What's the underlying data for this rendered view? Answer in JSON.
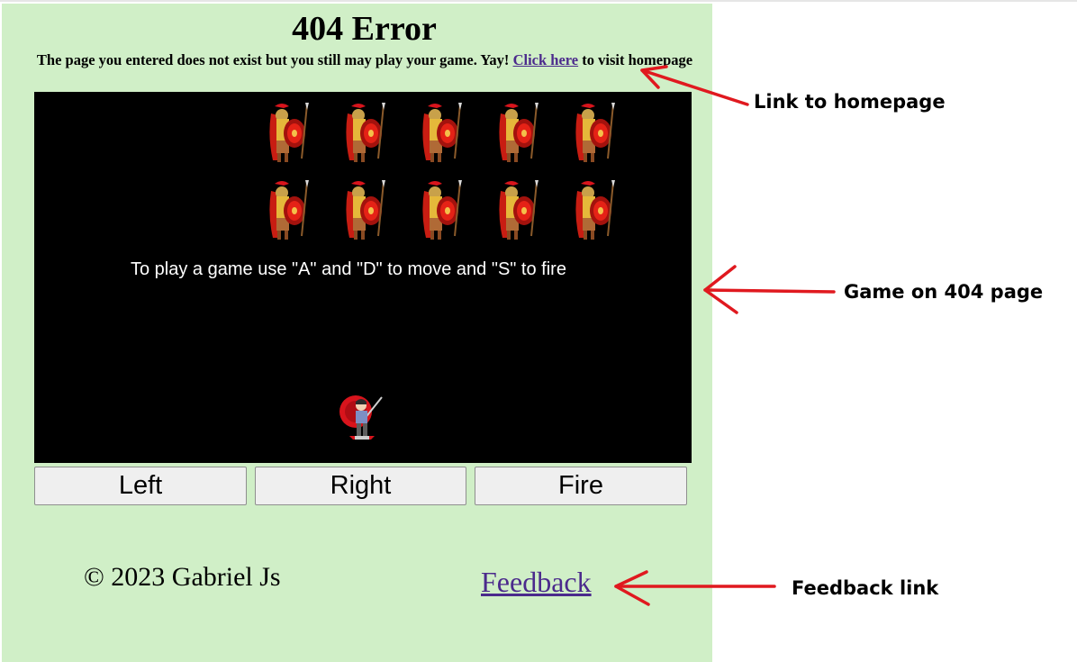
{
  "page": {
    "title": "404 Error",
    "subtitle_before": "The page you entered does not exist but you still may play your game. Yay! ",
    "home_link_label": "Click here",
    "subtitle_after": " to visit homepage"
  },
  "game": {
    "instructions": "To play a game use \"A\" and \"D\" to move and \"S\" to fire",
    "enemy_rows": 2,
    "enemy_cols": 5,
    "enemy_icon": "spartan-warrior-icon",
    "player_icon": "player-soldier-icon"
  },
  "controls": {
    "left_label": "Left",
    "right_label": "Right",
    "fire_label": "Fire"
  },
  "footer": {
    "copyright": "© 2023 Gabriel Js",
    "feedback_label": "Feedback"
  },
  "annotations": {
    "homepage_link": "Link to homepage",
    "game": "Game on 404 page",
    "feedback_link": "Feedback link"
  },
  "colors": {
    "page_background": "#d0efc7",
    "game_background": "#000000",
    "link": "#4b2a8c",
    "arrow": "#e0191f"
  }
}
